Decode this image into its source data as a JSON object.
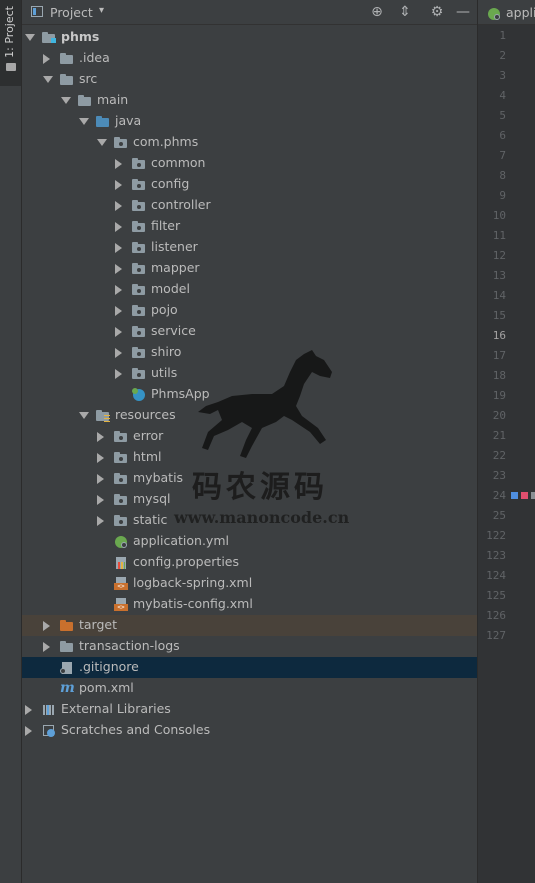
{
  "tool_window": {
    "tab_label": "1: Project"
  },
  "panel": {
    "title": "Project",
    "dropdown_glyph": "▾",
    "actions": [
      {
        "name": "locate-icon",
        "glyph": "⊕"
      },
      {
        "name": "collapse-all-icon",
        "glyph": "⇕"
      },
      {
        "name": "settings-icon",
        "glyph": "⚙"
      },
      {
        "name": "hide-icon",
        "glyph": "—"
      }
    ]
  },
  "tree": [
    {
      "label": "phms",
      "depth": 0,
      "arrow": "expanded",
      "icon": "module-folder",
      "bold": true
    },
    {
      "label": ".idea",
      "depth": 1,
      "arrow": "collapsed",
      "icon": "folder"
    },
    {
      "label": "src",
      "depth": 1,
      "arrow": "expanded",
      "icon": "folder"
    },
    {
      "label": "main",
      "depth": 2,
      "arrow": "expanded",
      "icon": "folder"
    },
    {
      "label": "java",
      "depth": 3,
      "arrow": "expanded",
      "icon": "source-folder"
    },
    {
      "label": "com.phms",
      "depth": 4,
      "arrow": "expanded",
      "icon": "package"
    },
    {
      "label": "common",
      "depth": 5,
      "arrow": "collapsed",
      "icon": "package"
    },
    {
      "label": "config",
      "depth": 5,
      "arrow": "collapsed",
      "icon": "package"
    },
    {
      "label": "controller",
      "depth": 5,
      "arrow": "collapsed",
      "icon": "package"
    },
    {
      "label": "filter",
      "depth": 5,
      "arrow": "collapsed",
      "icon": "package"
    },
    {
      "label": "listener",
      "depth": 5,
      "arrow": "collapsed",
      "icon": "package"
    },
    {
      "label": "mapper",
      "depth": 5,
      "arrow": "collapsed",
      "icon": "package"
    },
    {
      "label": "model",
      "depth": 5,
      "arrow": "collapsed",
      "icon": "package"
    },
    {
      "label": "pojo",
      "depth": 5,
      "arrow": "collapsed",
      "icon": "package"
    },
    {
      "label": "service",
      "depth": 5,
      "arrow": "collapsed",
      "icon": "package"
    },
    {
      "label": "shiro",
      "depth": 5,
      "arrow": "collapsed",
      "icon": "package"
    },
    {
      "label": "utils",
      "depth": 5,
      "arrow": "collapsed",
      "icon": "package"
    },
    {
      "label": "PhmsApp",
      "depth": 5,
      "arrow": "none",
      "icon": "spring-class"
    },
    {
      "label": "resources",
      "depth": 3,
      "arrow": "expanded",
      "icon": "resources-folder"
    },
    {
      "label": "error",
      "depth": 4,
      "arrow": "collapsed",
      "icon": "package"
    },
    {
      "label": "html",
      "depth": 4,
      "arrow": "collapsed",
      "icon": "package"
    },
    {
      "label": "mybatis",
      "depth": 4,
      "arrow": "collapsed",
      "icon": "package"
    },
    {
      "label": "mysql",
      "depth": 4,
      "arrow": "collapsed",
      "icon": "package"
    },
    {
      "label": "static",
      "depth": 4,
      "arrow": "collapsed",
      "icon": "package"
    },
    {
      "label": "application.yml",
      "depth": 4,
      "arrow": "none",
      "icon": "spring-config"
    },
    {
      "label": "config.properties",
      "depth": 4,
      "arrow": "none",
      "icon": "properties"
    },
    {
      "label": "logback-spring.xml",
      "depth": 4,
      "arrow": "none",
      "icon": "xml"
    },
    {
      "label": "mybatis-config.xml",
      "depth": 4,
      "arrow": "none",
      "icon": "xml"
    },
    {
      "label": "target",
      "depth": 1,
      "arrow": "collapsed",
      "icon": "excluded-folder",
      "highlight": "target"
    },
    {
      "label": "transaction-logs",
      "depth": 1,
      "arrow": "collapsed",
      "icon": "folder"
    },
    {
      "label": ".gitignore",
      "depth": 1,
      "arrow": "none",
      "icon": "gitignore",
      "highlight": "focus"
    },
    {
      "label": "pom.xml",
      "depth": 1,
      "arrow": "none",
      "icon": "maven"
    },
    {
      "label": "External Libraries",
      "depth": 0,
      "arrow": "collapsed",
      "icon": "libraries"
    },
    {
      "label": "Scratches and Consoles",
      "depth": 0,
      "arrow": "collapsed",
      "icon": "scratches"
    }
  ],
  "editor": {
    "tab_label": "appli",
    "line_numbers": [
      "1",
      "2",
      "3",
      "4",
      "5",
      "6",
      "7",
      "8",
      "9",
      "10",
      "11",
      "12",
      "13",
      "14",
      "15",
      "16",
      "17",
      "18",
      "19",
      "20",
      "21",
      "22",
      "23",
      "24",
      "25",
      "122",
      "123",
      "124",
      "125",
      "126",
      "127"
    ],
    "current_line": "16",
    "marker_line": "24",
    "marker_colors": [
      "#4f8fe0",
      "#e04f6e",
      "#8a8f94"
    ]
  },
  "watermark": {
    "chinese": "码农源码",
    "url": "www.manoncode.cn"
  },
  "colors": {
    "panel_bg": "#3c3f41",
    "selection_focus": "#0d293e",
    "selection_target": "#49423a",
    "text": "#bbbbbb",
    "folder_blue": "#4c8bb8",
    "folder_orange": "#c9702d"
  }
}
